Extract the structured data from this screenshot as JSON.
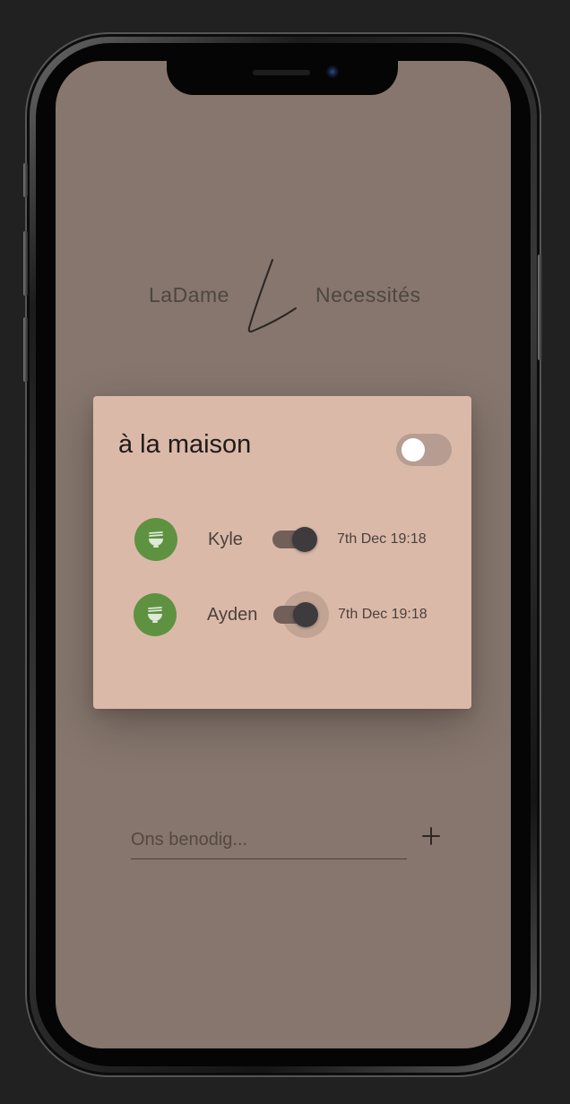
{
  "brand": {
    "left_text": "LaDame",
    "right_text": "Necessités",
    "logo_icon": "script-l-logo"
  },
  "card": {
    "title": "à la maison",
    "main_toggle_on": false,
    "rows": [
      {
        "name": "Kyle",
        "icon": "noodle-bowl-icon",
        "toggle_on": true,
        "timestamp": "7th Dec 19:18"
      },
      {
        "name": "Ayden",
        "icon": "noodle-bowl-icon",
        "toggle_on": true,
        "timestamp": "7th Dec 19:18"
      }
    ]
  },
  "input": {
    "placeholder": "Ons benodig...",
    "value": ""
  },
  "add_button": {
    "label": "+",
    "icon": "plus-icon"
  },
  "colors": {
    "screen_bg": "#86766d",
    "card_bg": "#dbb9a9",
    "avatar_bg": "#5e9241"
  }
}
